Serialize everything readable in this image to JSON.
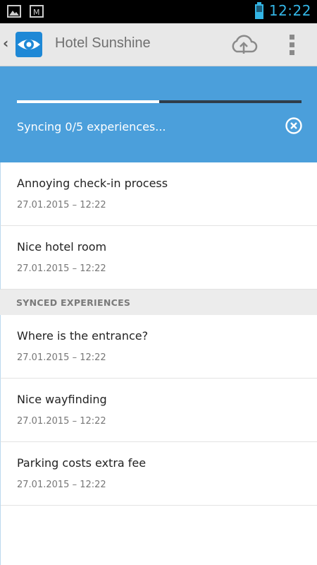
{
  "status_bar": {
    "time": "12:22",
    "icons": [
      "image-icon",
      "signal-letter-icon",
      "battery-icon"
    ],
    "time_color": "#33b5e5"
  },
  "action_bar": {
    "up_icon": "chevron-left-icon",
    "logo_icon": "eye-logo-icon",
    "title": "Hotel Sunshine",
    "actions": [
      "cloud-upload-icon",
      "overflow-menu-icon"
    ]
  },
  "sync": {
    "progress_fraction": 0.5,
    "status_text": "Syncing 0/5 experiences...",
    "cancel_icon": "cancel-circle-icon",
    "panel_color": "#4b9fdb"
  },
  "pending_items": [
    {
      "title": "Annoying check-in process",
      "timestamp": "27.01.2015 – 12:22"
    },
    {
      "title": "Nice hotel room",
      "timestamp": "27.01.2015 – 12:22"
    }
  ],
  "synced_section": {
    "label": "SYNCED EXPERIENCES",
    "items": [
      {
        "title": "Where is the entrance?",
        "timestamp": "27.01.2015 – 12:22"
      },
      {
        "title": "Nice wayfinding",
        "timestamp": "27.01.2015 – 12:22"
      },
      {
        "title": "Parking costs extra fee",
        "timestamp": "27.01.2015 – 12:22"
      }
    ]
  }
}
